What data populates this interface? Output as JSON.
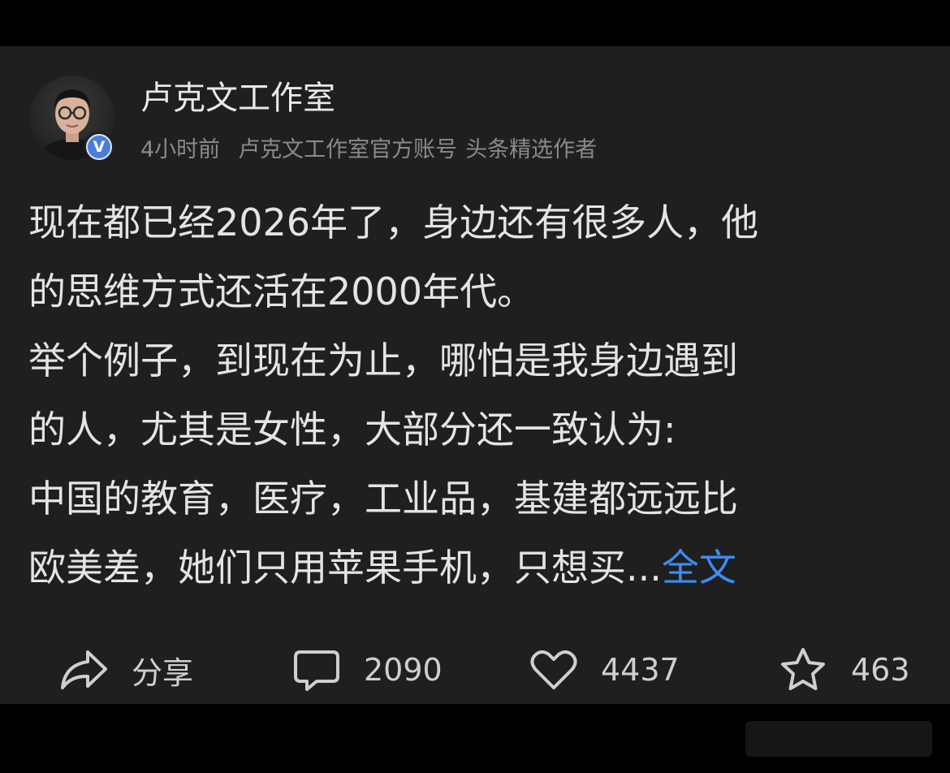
{
  "author": {
    "name": "卢克文工作室",
    "verified_badge": "V",
    "time": "4小时前",
    "account_desc": "卢克文工作室官方账号",
    "tag": "头条精选作者"
  },
  "post": {
    "lines": [
      "现在都已经2026年了，身边还有很多人，他",
      "的思维方式还活在2000年代。",
      "举个例子，到现在为止，哪怕是我身边遇到",
      "的人，尤其是女性，大部分还一致认为:",
      "中国的教育，医疗，工业品，基建都远远比"
    ],
    "last_line": "欧美差，她们只用苹果手机，只想买...",
    "more_link": "全文"
  },
  "actions": {
    "share_label": "分享",
    "comment_count": "2090",
    "like_count": "4437",
    "favorite_count": "463"
  },
  "colors": {
    "background": "#000000",
    "card": "#1f1f1f",
    "text": "#e4e4e4",
    "muted": "#8a8a8a",
    "link": "#3d8cf4"
  },
  "icons": [
    "share-icon",
    "comment-icon",
    "heart-icon",
    "star-icon",
    "verified-icon"
  ]
}
